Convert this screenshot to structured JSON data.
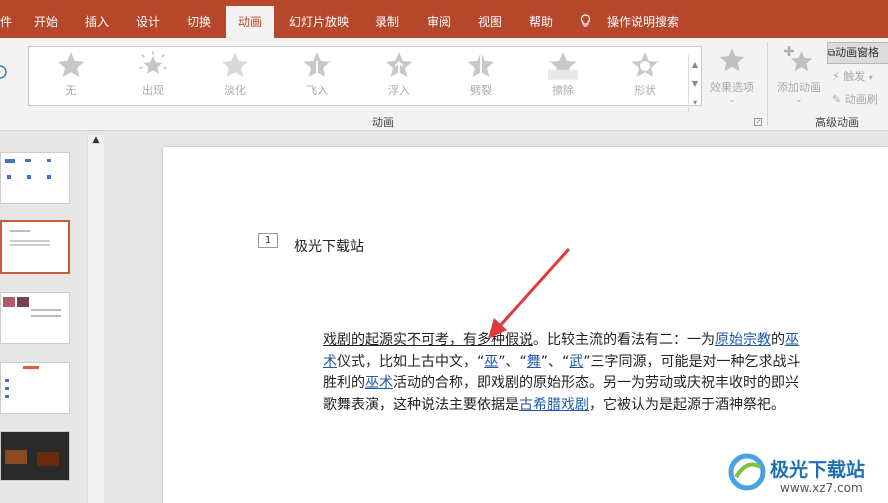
{
  "tabs": [
    {
      "label": "开始"
    },
    {
      "label": "插入"
    },
    {
      "label": "设计"
    },
    {
      "label": "切换"
    },
    {
      "label": "动画"
    },
    {
      "label": "幻灯片放映"
    },
    {
      "label": "录制"
    },
    {
      "label": "审阅"
    },
    {
      "label": "视图"
    },
    {
      "label": "帮助"
    }
  ],
  "tab_left_cut": "件",
  "search_label": "操作说明搜索",
  "animations": [
    {
      "label": "无"
    },
    {
      "label": "出现"
    },
    {
      "label": "淡化"
    },
    {
      "label": "飞入"
    },
    {
      "label": "浮入"
    },
    {
      "label": "劈裂"
    },
    {
      "label": "擦除"
    },
    {
      "label": "形状"
    }
  ],
  "effect_options": "效果选项",
  "add_animation": "添加动画",
  "animation_pane": "动画窗格",
  "trigger": "触发",
  "anim_brush": "动画刷",
  "group_animation": "动画",
  "group_advanced": "高级动画",
  "slide": {
    "number": "1",
    "title": "极光下载站",
    "para_line1_a": "戏剧的起源实不可考，有多种假说",
    "para_line1_b": "。比较主流的看法有二：一为",
    "link_yuanshi": "原始宗教",
    "de": "的",
    "link_wushu": "巫术",
    "para_line2_a": "仪式，比如上古中文，“",
    "link_wu": "巫",
    "sep1": "”、“",
    "link_wu2": "舞",
    "sep2": "”、“",
    "link_wu3": "武",
    "para_line2_b": "”三字同源，可能是对一种乞求战斗胜利的",
    "link_wushu2": "巫术",
    "para_line3": "活动的合称，即戏剧的原始形态。另一为劳动或庆祝丰收时的即兴歌舞表演，这种说法主要依据是",
    "link_greek": "古希腊戏剧",
    "para_end": "，它被认为是起源于酒神祭祀。"
  },
  "watermark": {
    "title": "极光下载站",
    "url": "www.xz7.com"
  },
  "colors": {
    "accent": "#b7472a",
    "link": "#1f5aa6",
    "arrow": "#e03a3a"
  }
}
